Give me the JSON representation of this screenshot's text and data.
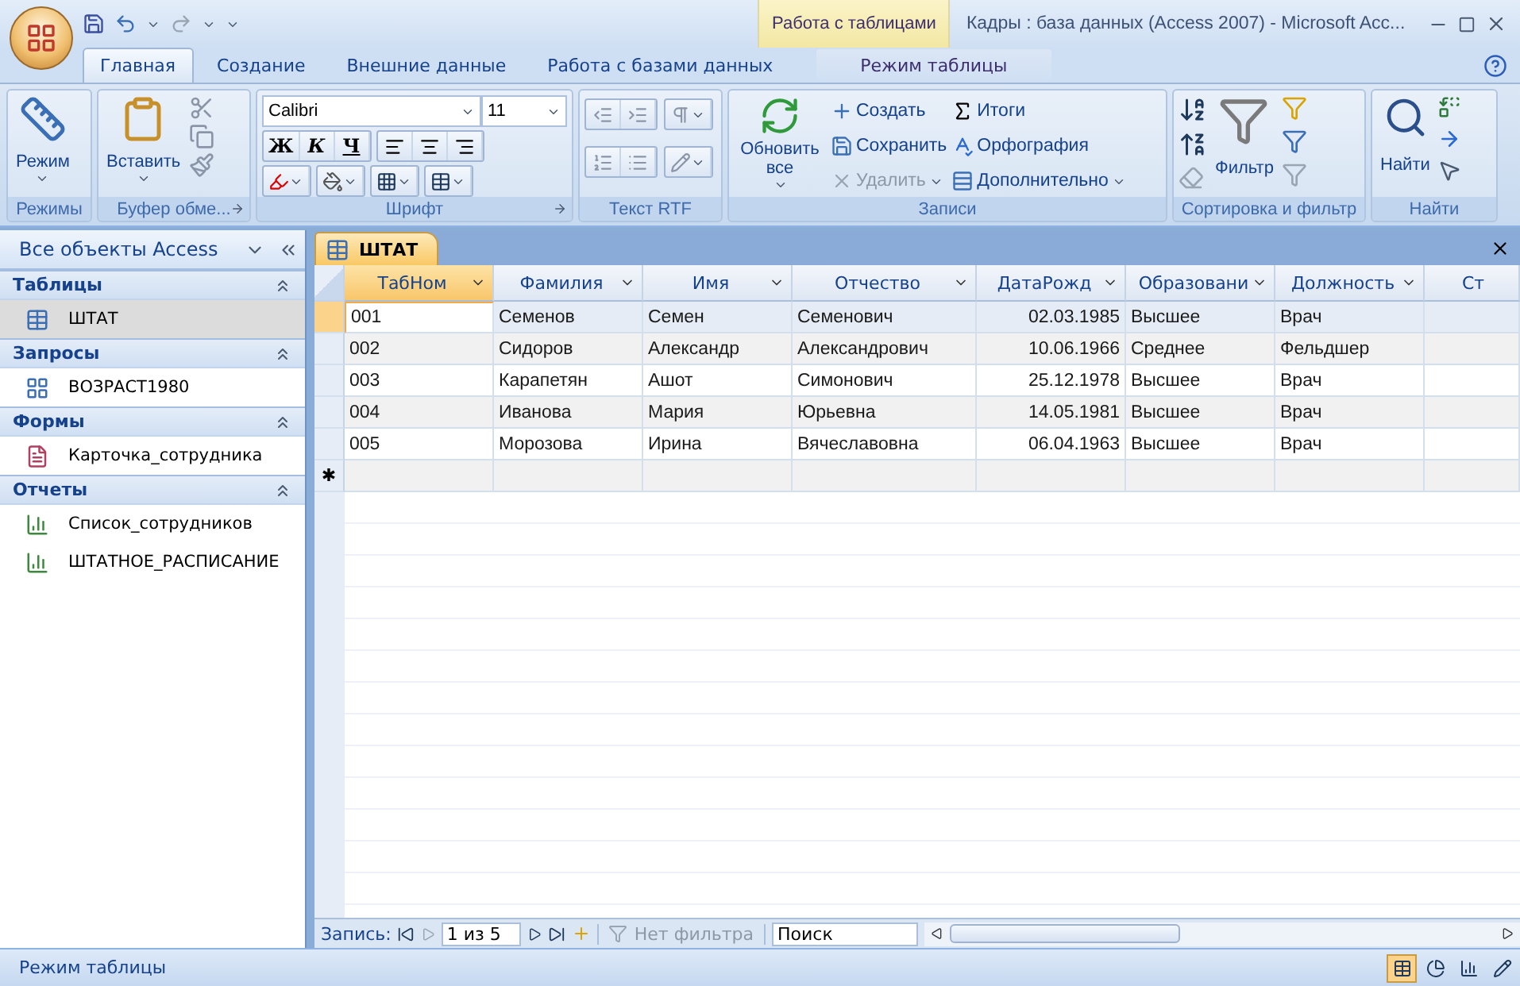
{
  "window": {
    "title": "Кадры : база данных (Access 2007) - Microsoft Acc..."
  },
  "contextual_group": "Работа с таблицами",
  "tabs": [
    {
      "label": "Главная",
      "selected": true,
      "kind": "standard"
    },
    {
      "label": "Создание",
      "selected": false,
      "kind": "standard"
    },
    {
      "label": "Внешние данные",
      "selected": false,
      "kind": "standard"
    },
    {
      "label": "Работа с базами данных",
      "selected": false,
      "kind": "standard"
    },
    {
      "label": "Режим таблицы",
      "selected": false,
      "kind": "contextual"
    }
  ],
  "ribbon": {
    "views": {
      "label": "Режимы",
      "mode_button": "Режим"
    },
    "clipboard": {
      "label": "Буфер обме...",
      "paste_button": "Вставить"
    },
    "font": {
      "label": "Шрифт",
      "font_name": "Calibri",
      "font_size": "11",
      "bold": "Ж",
      "italic": "К",
      "underline": "Ч"
    },
    "rich_text": {
      "label": "Текст RTF"
    },
    "records": {
      "label": "Записи",
      "refresh_button": "Обновить все",
      "buttons": [
        {
          "label": "Создать",
          "disabled": false,
          "dropdown": false
        },
        {
          "label": "Сохранить",
          "disabled": false,
          "dropdown": false
        },
        {
          "label": "Удалить",
          "disabled": true,
          "dropdown": true
        },
        {
          "label": "Итоги",
          "disabled": false,
          "dropdown": false
        },
        {
          "label": "Орфография",
          "disabled": false,
          "dropdown": false
        },
        {
          "label": "Дополнительно",
          "disabled": false,
          "dropdown": true
        }
      ]
    },
    "sort_filter": {
      "label": "Сортировка и фильтр",
      "filter_button": "Фильтр"
    },
    "find": {
      "label": "Найти",
      "find_button": "Найти"
    }
  },
  "nav_pane": {
    "title": "Все объекты Access",
    "sections": [
      {
        "label": "Таблицы",
        "expanded": true,
        "items": [
          {
            "label": "ШТАТ",
            "kind": "table",
            "selected": true
          }
        ]
      },
      {
        "label": "Запросы",
        "expanded": true,
        "items": [
          {
            "label": "ВОЗРАСТ1980",
            "kind": "query",
            "selected": false
          }
        ]
      },
      {
        "label": "Формы",
        "expanded": true,
        "items": [
          {
            "label": "Карточка_сотрудника",
            "kind": "form",
            "selected": false
          }
        ]
      },
      {
        "label": "Отчеты",
        "expanded": true,
        "items": [
          {
            "label": "Список_сотрудников",
            "kind": "report",
            "selected": false
          },
          {
            "label": "ШТАТНОЕ_РАСПИСАНИЕ",
            "kind": "report",
            "selected": false
          }
        ]
      }
    ]
  },
  "document_tab": {
    "label": "ШТАТ"
  },
  "table": {
    "columns": [
      {
        "label": "ТабНом",
        "selected": true,
        "kind": "text"
      },
      {
        "label": "Фамилия",
        "selected": false,
        "kind": "text"
      },
      {
        "label": "Имя",
        "selected": false,
        "kind": "text"
      },
      {
        "label": "Отчество",
        "selected": false,
        "kind": "text"
      },
      {
        "label": "ДатаРожд",
        "selected": false,
        "kind": "date"
      },
      {
        "label": "Образовани",
        "selected": false,
        "kind": "text"
      },
      {
        "label": "Должность",
        "selected": false,
        "kind": "text"
      },
      {
        "label": "Ст",
        "selected": false,
        "kind": "cut"
      }
    ],
    "rows": [
      {
        "selected": true,
        "cells": [
          "001",
          "Семенов",
          "Семен",
          "Семенович",
          "02.03.1985",
          "Высшее",
          "Врач"
        ]
      },
      {
        "selected": false,
        "cells": [
          "002",
          "Сидоров",
          "Александр",
          "Александрович",
          "10.06.1966",
          "Среднее",
          "Фельдшер"
        ]
      },
      {
        "selected": false,
        "cells": [
          "003",
          "Карапетян",
          "Ашот",
          "Симонович",
          "25.12.1978",
          "Высшее",
          "Врач"
        ]
      },
      {
        "selected": false,
        "cells": [
          "004",
          "Иванова",
          "Мария",
          "Юрьевна",
          "14.05.1981",
          "Высшее",
          "Врач"
        ]
      },
      {
        "selected": false,
        "cells": [
          "005",
          "Морозова",
          "Ирина",
          "Вячеславовна",
          "06.04.1963",
          "Высшее",
          "Врач"
        ]
      }
    ],
    "new_row_marker": "✱"
  },
  "record_nav": {
    "label": "Запись:",
    "position": "1 из 5",
    "filter": "Нет фильтра",
    "search": {
      "placeholder": "Поиск"
    }
  },
  "status_bar": {
    "text": "Режим таблицы",
    "views": [
      {
        "selected": true
      },
      {
        "selected": false
      },
      {
        "selected": false
      },
      {
        "selected": false
      }
    ]
  }
}
